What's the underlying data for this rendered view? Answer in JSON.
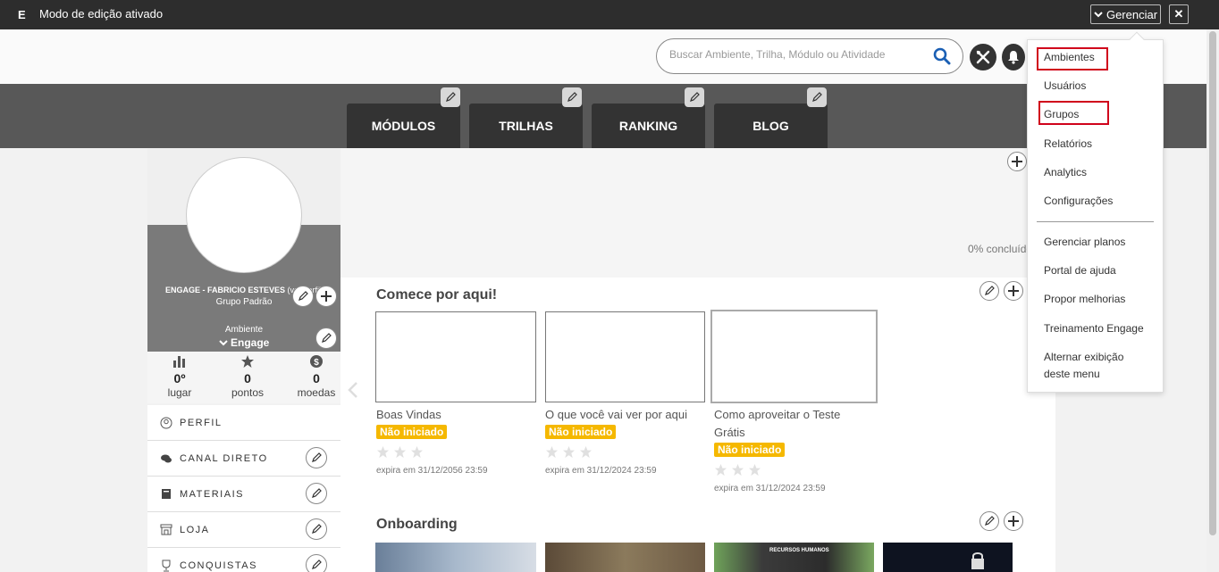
{
  "topbar": {
    "logo": "E",
    "mode_text": "Modo de edição ativado",
    "manage_label": "Gerenciar",
    "close_label": "✕"
  },
  "header": {
    "search_placeholder": "Buscar Ambiente, Trilha, Módulo ou Atividade"
  },
  "nav": {
    "tabs": [
      {
        "label": "MÓDULOS"
      },
      {
        "label": "TRILHAS"
      },
      {
        "label": "RANKING"
      },
      {
        "label": "BLOG"
      }
    ]
  },
  "profile": {
    "name": "ENGAGE - FABRICIO ESTEVES",
    "view_profile": "(ver perfil)",
    "group": "Grupo Padrão",
    "environment_label": "Ambiente",
    "environment_value": "Engage"
  },
  "stats": [
    {
      "value": "0º",
      "label": "lugar"
    },
    {
      "value": "0",
      "label": "pontos"
    },
    {
      "value": "0",
      "label": "moedas"
    }
  ],
  "menu": [
    {
      "label": "PERFIL"
    },
    {
      "label": "CANAL DIRETO"
    },
    {
      "label": "MATERIAIS"
    },
    {
      "label": "LOJA"
    },
    {
      "label": "CONQUISTAS"
    }
  ],
  "progress_text": "0% concluído",
  "sections": {
    "start": {
      "title": "Comece por aqui!",
      "cards": [
        {
          "title": "Boas Vindas",
          "status": "Não iniciado",
          "expires": "expira em 31/12/2056 23:59"
        },
        {
          "title": "O que você vai ver por aqui",
          "status": "Não iniciado",
          "expires": "expira em 31/12/2024 23:59"
        },
        {
          "title": "Como aproveitar o Teste Grátis",
          "status": "Não iniciado",
          "expires": "expira em 31/12/2024 23:59"
        }
      ]
    },
    "onboarding": {
      "title": "Onboarding",
      "photo_text": "RECURSOS HUMANOS"
    }
  },
  "dropdown": {
    "items": [
      {
        "label": "Ambientes"
      },
      {
        "label": "Usuários"
      },
      {
        "label": "Grupos"
      },
      {
        "label": "Relatórios"
      },
      {
        "label": "Analytics"
      },
      {
        "label": "Configurações"
      },
      {
        "label": "Gerenciar planos"
      },
      {
        "label": "Portal de ajuda"
      },
      {
        "label": "Propor melhorias"
      },
      {
        "label": "Treinamento Engage"
      },
      {
        "label": "Alternar exibição deste menu"
      }
    ]
  },
  "colors": {
    "topbar": "#2d2d2d",
    "navband": "#585858",
    "tab": "#333333",
    "badge": "#f5b800",
    "highlight": "#d0021b",
    "search_icon": "#1a5fb4"
  }
}
